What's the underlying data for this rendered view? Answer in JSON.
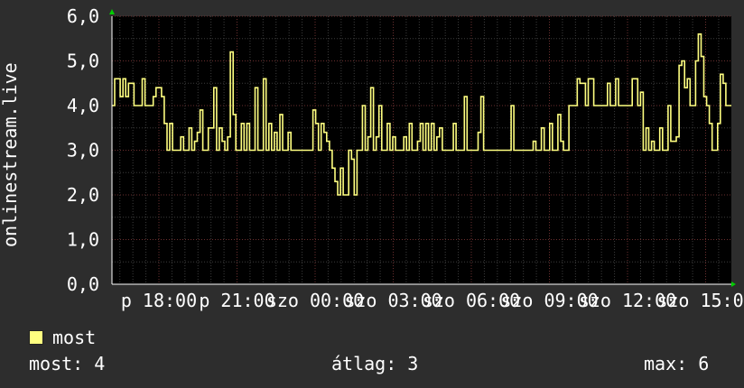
{
  "chart_data": {
    "type": "line",
    "title": "",
    "ylabel": "onlinestream.live",
    "xlabel": "",
    "ylim": [
      0,
      6
    ],
    "yticks": [
      "0,0",
      "1,0",
      "2,0",
      "3,0",
      "4,0",
      "5,0",
      "6,0"
    ],
    "xticks": [
      "p 18:00",
      "p 21:00",
      "szo 00:00",
      "szo 03:00",
      "szo 06:00",
      "szo 09:00",
      "szo 12:00",
      "szo 15:00"
    ],
    "grid": true,
    "series": [
      {
        "name": "most",
        "color": "#ffff80",
        "values": [
          4.0,
          4.6,
          4.6,
          4.2,
          4.6,
          4.2,
          4.5,
          4.5,
          4.0,
          4.0,
          4.0,
          4.6,
          4.0,
          4.0,
          4.0,
          4.2,
          4.4,
          4.4,
          4.2,
          3.6,
          3.0,
          3.6,
          3.0,
          3.0,
          3.0,
          3.3,
          3.0,
          3.0,
          3.5,
          3.0,
          3.2,
          3.4,
          3.9,
          3.0,
          3.0,
          3.5,
          3.5,
          4.4,
          3.0,
          3.5,
          3.2,
          3.0,
          3.3,
          5.2,
          3.8,
          3.0,
          3.0,
          3.6,
          3.0,
          3.6,
          3.0,
          3.0,
          4.4,
          3.0,
          3.0,
          4.6,
          3.0,
          3.6,
          3.0,
          3.4,
          3.0,
          3.8,
          3.0,
          3.0,
          3.4,
          3.0,
          3.0,
          3.0,
          3.0,
          3.0,
          3.0,
          3.0,
          3.0,
          3.9,
          3.6,
          3.0,
          3.6,
          3.4,
          3.2,
          3.0,
          2.6,
          2.3,
          2.0,
          2.6,
          2.0,
          2.0,
          3.0,
          2.8,
          2.0,
          3.0,
          3.0,
          4.0,
          3.0,
          3.3,
          4.4,
          3.0,
          3.3,
          4.0,
          3.0,
          3.0,
          3.6,
          3.0,
          3.3,
          3.0,
          3.0,
          3.0,
          3.3,
          3.0,
          3.6,
          3.0,
          3.0,
          3.2,
          3.6,
          3.0,
          3.6,
          3.0,
          3.6,
          3.0,
          3.3,
          3.5,
          3.0,
          3.0,
          3.0,
          3.0,
          3.6,
          3.0,
          3.0,
          3.0,
          4.2,
          3.0,
          3.0,
          3.0,
          3.0,
          3.4,
          4.2,
          3.0,
          3.0,
          3.0,
          3.0,
          3.0,
          3.0,
          3.0,
          3.0,
          3.0,
          3.0,
          4.0,
          3.0,
          3.0,
          3.0,
          3.0,
          3.0,
          3.0,
          3.0,
          3.2,
          3.0,
          3.0,
          3.5,
          3.0,
          3.0,
          3.6,
          3.0,
          3.0,
          3.8,
          3.2,
          3.0,
          3.0,
          4.0,
          4.0,
          4.0,
          4.6,
          4.5,
          4.5,
          4.0,
          4.6,
          4.6,
          4.0,
          4.0,
          4.0,
          4.0,
          4.0,
          4.5,
          4.0,
          4.0,
          4.6,
          4.0,
          4.0,
          4.0,
          4.0,
          4.0,
          4.6,
          4.6,
          4.0,
          4.3,
          3.0,
          3.5,
          3.0,
          3.2,
          3.0,
          3.0,
          3.5,
          3.0,
          3.0,
          4.0,
          3.2,
          3.2,
          3.3,
          4.9,
          5.0,
          4.4,
          4.6,
          4.0,
          4.0,
          5.0,
          5.6,
          5.1,
          4.2,
          4.0,
          3.6,
          3.0,
          3.0,
          3.6,
          4.7,
          4.5,
          4.0,
          4.0
        ]
      }
    ]
  },
  "legend": {
    "label": "most",
    "color": "#ffff80"
  },
  "stats": {
    "current": "most: 4",
    "average": "átlag: 3",
    "max": "max: 6"
  }
}
